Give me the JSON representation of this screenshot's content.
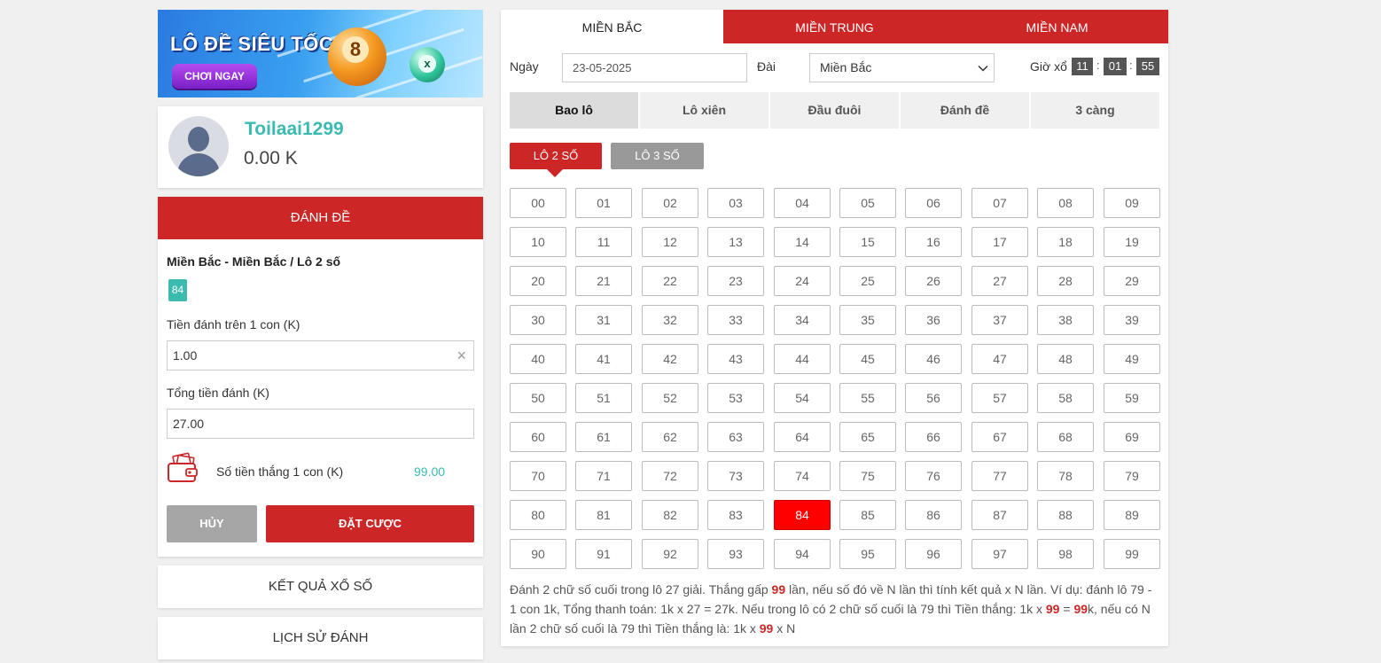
{
  "banner": {
    "title": "LÔ ĐỀ SIÊU TỐC",
    "button": "CHƠI NGAY",
    "ball_main": "8",
    "ball_small": "x"
  },
  "user": {
    "name": "Toilaai1299",
    "balance": "0.00 K",
    "avatar_icon": "user-avatar-icon"
  },
  "bet_panel": {
    "header": "ĐÁNH ĐỀ",
    "subtitle": "Miền Bắc - Miền Bắc / Lô 2 số",
    "selected_number": "84",
    "stake_label": "Tiền đánh trên 1 con (K)",
    "stake_value": "1.00",
    "clear_icon": "×",
    "total_label": "Tổng tiền đánh (K)",
    "total_value": "27.00",
    "win_label": "Số tiền thắng 1 con (K)",
    "win_value": "99.00",
    "wallet_icon": "wallet-money-icon",
    "cancel": "HỦY",
    "place": "ĐẶT CƯỢC"
  },
  "links": {
    "results": "KẾT QUẢ XỔ SỐ",
    "history": "LỊCH SỬ ĐÁNH"
  },
  "regions": [
    "MIỀN BẮC",
    "MIỀN TRUNG",
    "MIỀN NAM"
  ],
  "active_region": 0,
  "filters": {
    "date_label": "Ngày",
    "date_value": "23-05-2025",
    "station_label": "Đài",
    "station_value": "Miền Bắc",
    "draw_time_label": "Giờ xổ",
    "hh": "11",
    "mm": "01",
    "ss": "55",
    "sep": ":"
  },
  "game_tabs": [
    "Bao lô",
    "Lô xiên",
    "Đầu đuôi",
    "Đánh đề",
    "3 càng"
  ],
  "active_game_tab": 0,
  "sub_tabs": [
    "LÔ 2 SỐ",
    "LÔ 3 SỐ"
  ],
  "active_sub_tab": 0,
  "numbers": [
    "00",
    "01",
    "02",
    "03",
    "04",
    "05",
    "06",
    "07",
    "08",
    "09",
    "10",
    "11",
    "12",
    "13",
    "14",
    "15",
    "16",
    "17",
    "18",
    "19",
    "20",
    "21",
    "22",
    "23",
    "24",
    "25",
    "26",
    "27",
    "28",
    "29",
    "30",
    "31",
    "32",
    "33",
    "34",
    "35",
    "36",
    "37",
    "38",
    "39",
    "40",
    "41",
    "42",
    "43",
    "44",
    "45",
    "46",
    "47",
    "48",
    "49",
    "50",
    "51",
    "52",
    "53",
    "54",
    "55",
    "56",
    "57",
    "58",
    "59",
    "60",
    "61",
    "62",
    "63",
    "64",
    "65",
    "66",
    "67",
    "68",
    "69",
    "70",
    "71",
    "72",
    "73",
    "74",
    "75",
    "76",
    "77",
    "78",
    "79",
    "80",
    "81",
    "82",
    "83",
    "84",
    "85",
    "86",
    "87",
    "88",
    "89",
    "90",
    "91",
    "92",
    "93",
    "94",
    "95",
    "96",
    "97",
    "98",
    "99"
  ],
  "selected_numbers": [
    "84"
  ],
  "description": {
    "p1": "Đánh 2 chữ số cuối trong lô 27 giải. Thắng gấp ",
    "h1": "99",
    "p2": " lần, nếu số đó về N lần thì tính kết quả x N lần. Ví dụ: đánh lô 79 - 1 con 1k, Tổng thanh toán: 1k x 27 = 27k. Nếu trong lô có 2 chữ số cuối là 79 thì Tiền thắng: 1k x ",
    "h2": "99",
    "p3": " = ",
    "h3": "99",
    "p4": "k, nếu có N lần 2 chữ số cuối là 79 thì Tiền thắng là: 1k x ",
    "h4": "99",
    "p5": " x N"
  },
  "colors": {
    "primary_red": "#cc2626",
    "teal": "#3bbbb0",
    "selected_red": "#ff0000",
    "gray_button": "#a6a6a6"
  }
}
